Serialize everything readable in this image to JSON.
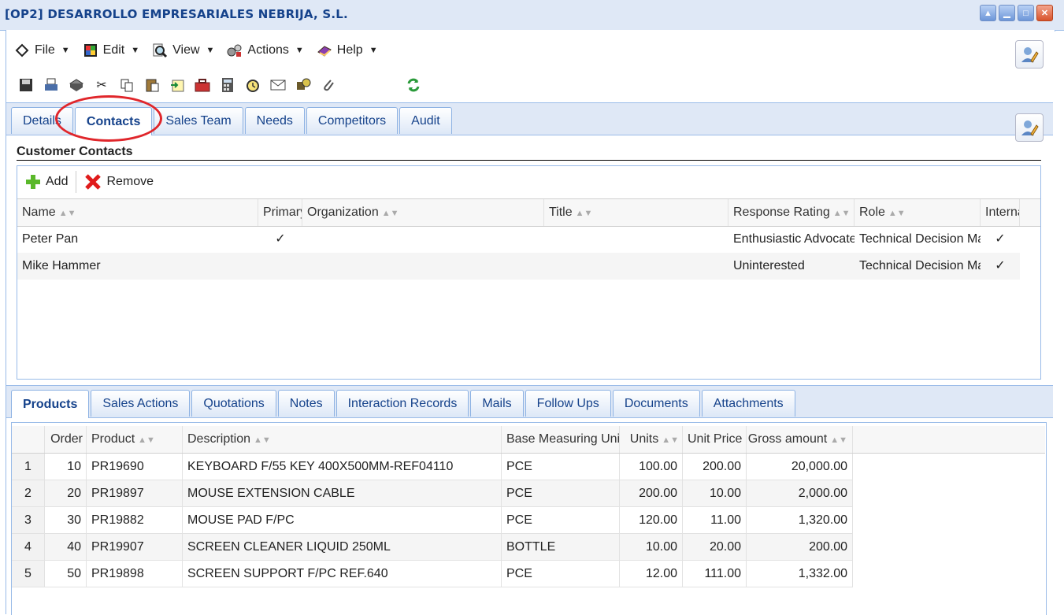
{
  "window": {
    "title": "[OP2] DESARROLLO EMPRESARIALES NEBRIJA, S.L."
  },
  "menu": [
    {
      "label": "File",
      "icon": "file-icon"
    },
    {
      "label": "Edit",
      "icon": "edit-icon"
    },
    {
      "label": "View",
      "icon": "view-icon"
    },
    {
      "label": "Actions",
      "icon": "actions-icon"
    },
    {
      "label": "Help",
      "icon": "help-icon"
    }
  ],
  "toolbar": [
    "save-icon",
    "print-icon",
    "print-preview-icon",
    "cut-icon",
    "copy-icon",
    "paste-icon",
    "export-icon",
    "toolbox-icon",
    "calculator-icon",
    "alarm-clock-icon",
    "mail-icon",
    "workflow-icon",
    "paperclip-icon",
    "refresh-icon"
  ],
  "tabs_top": [
    {
      "label": "Details"
    },
    {
      "label": "Contacts",
      "active": true
    },
    {
      "label": "Sales Team"
    },
    {
      "label": "Needs"
    },
    {
      "label": "Competitors"
    },
    {
      "label": "Audit"
    }
  ],
  "contacts": {
    "title": "Customer Contacts",
    "add_label": "Add",
    "remove_label": "Remove",
    "columns": [
      "Name",
      "Primary",
      "Organization",
      "Title",
      "Response Rating",
      "Role",
      "Internal"
    ],
    "rows": [
      {
        "name": "Peter Pan",
        "primary": "✓",
        "organization": "",
        "title": "",
        "rating": "Enthusiastic Advocate",
        "role": "Technical Decision Maker",
        "internal": "✓"
      },
      {
        "name": "Mike Hammer",
        "primary": "",
        "organization": "",
        "title": "",
        "rating": "Uninterested",
        "role": "Technical Decision Maker",
        "internal": "✓"
      }
    ]
  },
  "tabs_bottom": [
    {
      "label": "Products",
      "active": true
    },
    {
      "label": "Sales Actions"
    },
    {
      "label": "Quotations"
    },
    {
      "label": "Notes"
    },
    {
      "label": "Interaction Records"
    },
    {
      "label": "Mails"
    },
    {
      "label": "Follow Ups"
    },
    {
      "label": "Documents"
    },
    {
      "label": "Attachments"
    }
  ],
  "products": {
    "columns": [
      "Order",
      "Product",
      "Description",
      "Base Measuring Unit",
      "Units",
      "Unit Price",
      "Gross amount"
    ],
    "rows": [
      {
        "n": "1",
        "order": "10",
        "product": "PR19690",
        "description": "KEYBOARD F/55 KEY 400X500MM-REF04110",
        "unit": "PCE",
        "units": "100.00",
        "price": "200.00",
        "gross": "20,000.00"
      },
      {
        "n": "2",
        "order": "20",
        "product": "PR19897",
        "description": "MOUSE EXTENSION CABLE",
        "unit": "PCE",
        "units": "200.00",
        "price": "10.00",
        "gross": "2,000.00"
      },
      {
        "n": "3",
        "order": "30",
        "product": "PR19882",
        "description": "MOUSE PAD F/PC",
        "unit": "PCE",
        "units": "120.00",
        "price": "11.00",
        "gross": "1,320.00"
      },
      {
        "n": "4",
        "order": "40",
        "product": "PR19907",
        "description": "SCREEN CLEANER LIQUID 250ML",
        "unit": "BOTTLE",
        "units": "10.00",
        "price": "20.00",
        "gross": "200.00"
      },
      {
        "n": "5",
        "order": "50",
        "product": "PR19898",
        "description": "SCREEN SUPPORT F/PC REF.640",
        "unit": "PCE",
        "units": "12.00",
        "price": "111.00",
        "gross": "1,332.00"
      }
    ]
  }
}
